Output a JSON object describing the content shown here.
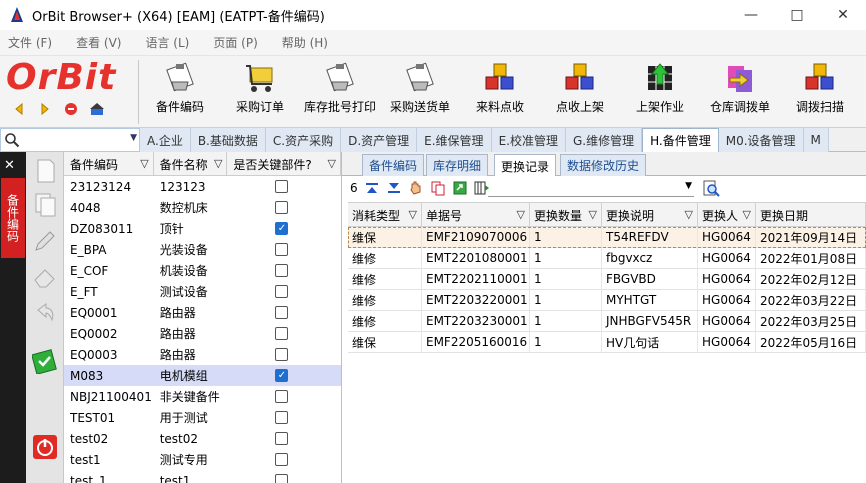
{
  "window": {
    "title": "OrBit Browser+ (X64) [EAM] (EATPT-备件编码)",
    "controls": [
      "—",
      "□",
      "✕"
    ]
  },
  "menu": [
    "文件 (F)",
    "查看 (V)",
    "语言 (L)",
    "页面 (P)",
    "帮助 (H)"
  ],
  "logo": {
    "text": "OrBit",
    "color": "#e5322d"
  },
  "toolbar": {
    "buttons": [
      {
        "label": "备件编码",
        "icon": "sheet-clip-icon"
      },
      {
        "label": "采购订单",
        "icon": "cart-icon"
      },
      {
        "label": "库存批号打印",
        "icon": "sheet-print-icon"
      },
      {
        "label": "采购送货单",
        "icon": "sheet-clip-icon"
      },
      {
        "label": "来料点收",
        "icon": "cubes-icon"
      },
      {
        "label": "点收上架",
        "icon": "cubes-icon"
      },
      {
        "label": "上架作业",
        "icon": "grid-up-arrow-icon"
      },
      {
        "label": "仓库调拨单",
        "icon": "transfer-icon"
      },
      {
        "label": "调拨扫描",
        "icon": "cubes-icon"
      }
    ]
  },
  "search": {
    "value": "",
    "placeholder": ""
  },
  "modules": [
    "A.企业",
    "B.基础数据",
    "C.资产采购",
    "D.资产管理",
    "E.维保管理",
    "E.校准管理",
    "G.维修管理",
    "H.备件管理",
    "M0.设备管理",
    "M"
  ],
  "active_module": "H.备件管理",
  "sidebar": {
    "close": "✕",
    "tab_label": "备件编码"
  },
  "left_grid": {
    "columns": [
      "备件编码",
      "备件名称",
      "是否关键部件?"
    ],
    "rows": [
      {
        "code": "23123124",
        "name": "123123",
        "critical": false,
        "selected": false
      },
      {
        "code": "4048",
        "name": "数控机床",
        "critical": false,
        "selected": false
      },
      {
        "code": "DZ083011",
        "name": "顶针",
        "critical": true,
        "selected": false
      },
      {
        "code": "E_BPA",
        "name": "光装设备",
        "critical": false,
        "selected": false
      },
      {
        "code": "E_COF",
        "name": "机装设备",
        "critical": false,
        "selected": false
      },
      {
        "code": "E_FT",
        "name": "测试设备",
        "critical": false,
        "selected": false
      },
      {
        "code": "EQ0001",
        "name": "路由器",
        "critical": false,
        "selected": false
      },
      {
        "code": "EQ0002",
        "name": "路由器",
        "critical": false,
        "selected": false
      },
      {
        "code": "EQ0003",
        "name": "路由器",
        "critical": false,
        "selected": false
      },
      {
        "code": "M083",
        "name": "电机模组",
        "critical": true,
        "selected": true
      },
      {
        "code": "NBJ21100401",
        "name": "非关键备件",
        "critical": false,
        "selected": false
      },
      {
        "code": "TEST01",
        "name": "用于测试",
        "critical": false,
        "selected": false
      },
      {
        "code": "test02",
        "name": "test02",
        "critical": false,
        "selected": false
      },
      {
        "code": "test1",
        "name": "测试专用",
        "critical": false,
        "selected": false
      },
      {
        "code": "test_1",
        "name": "test1",
        "critical": false,
        "selected": false
      }
    ]
  },
  "right_panel": {
    "subtabs": [
      "备件编码",
      "库存明细",
      "更换记录",
      "数据修改历史"
    ],
    "active_subtab": "更换记录",
    "record_count": "6",
    "columns": [
      "消耗类型",
      "单据号",
      "更换数量",
      "更换说明",
      "更换人",
      "更换日期"
    ],
    "rows": [
      [
        "维保",
        "EMF2109070006",
        "1",
        "T54REFDV",
        "HG0064",
        "2021年09月14日"
      ],
      [
        "维修",
        "EMT2201080001",
        "1",
        "fbgvxcz",
        "HG0064",
        "2022年01月08日"
      ],
      [
        "维修",
        "EMT2202110001",
        "1",
        "FBGVBD",
        "HG0064",
        "2022年02月12日"
      ],
      [
        "维修",
        "EMT2203220001",
        "1",
        "MYHTGT",
        "HG0064",
        "2022年03月22日"
      ],
      [
        "维修",
        "EMT2203230001",
        "1",
        "JNHBGFV545R",
        "HG0064",
        "2022年03月25日"
      ],
      [
        "维保",
        "EMF2205160016",
        "1",
        "HV几句话",
        "HG0064",
        "2022年05月16日"
      ]
    ]
  }
}
